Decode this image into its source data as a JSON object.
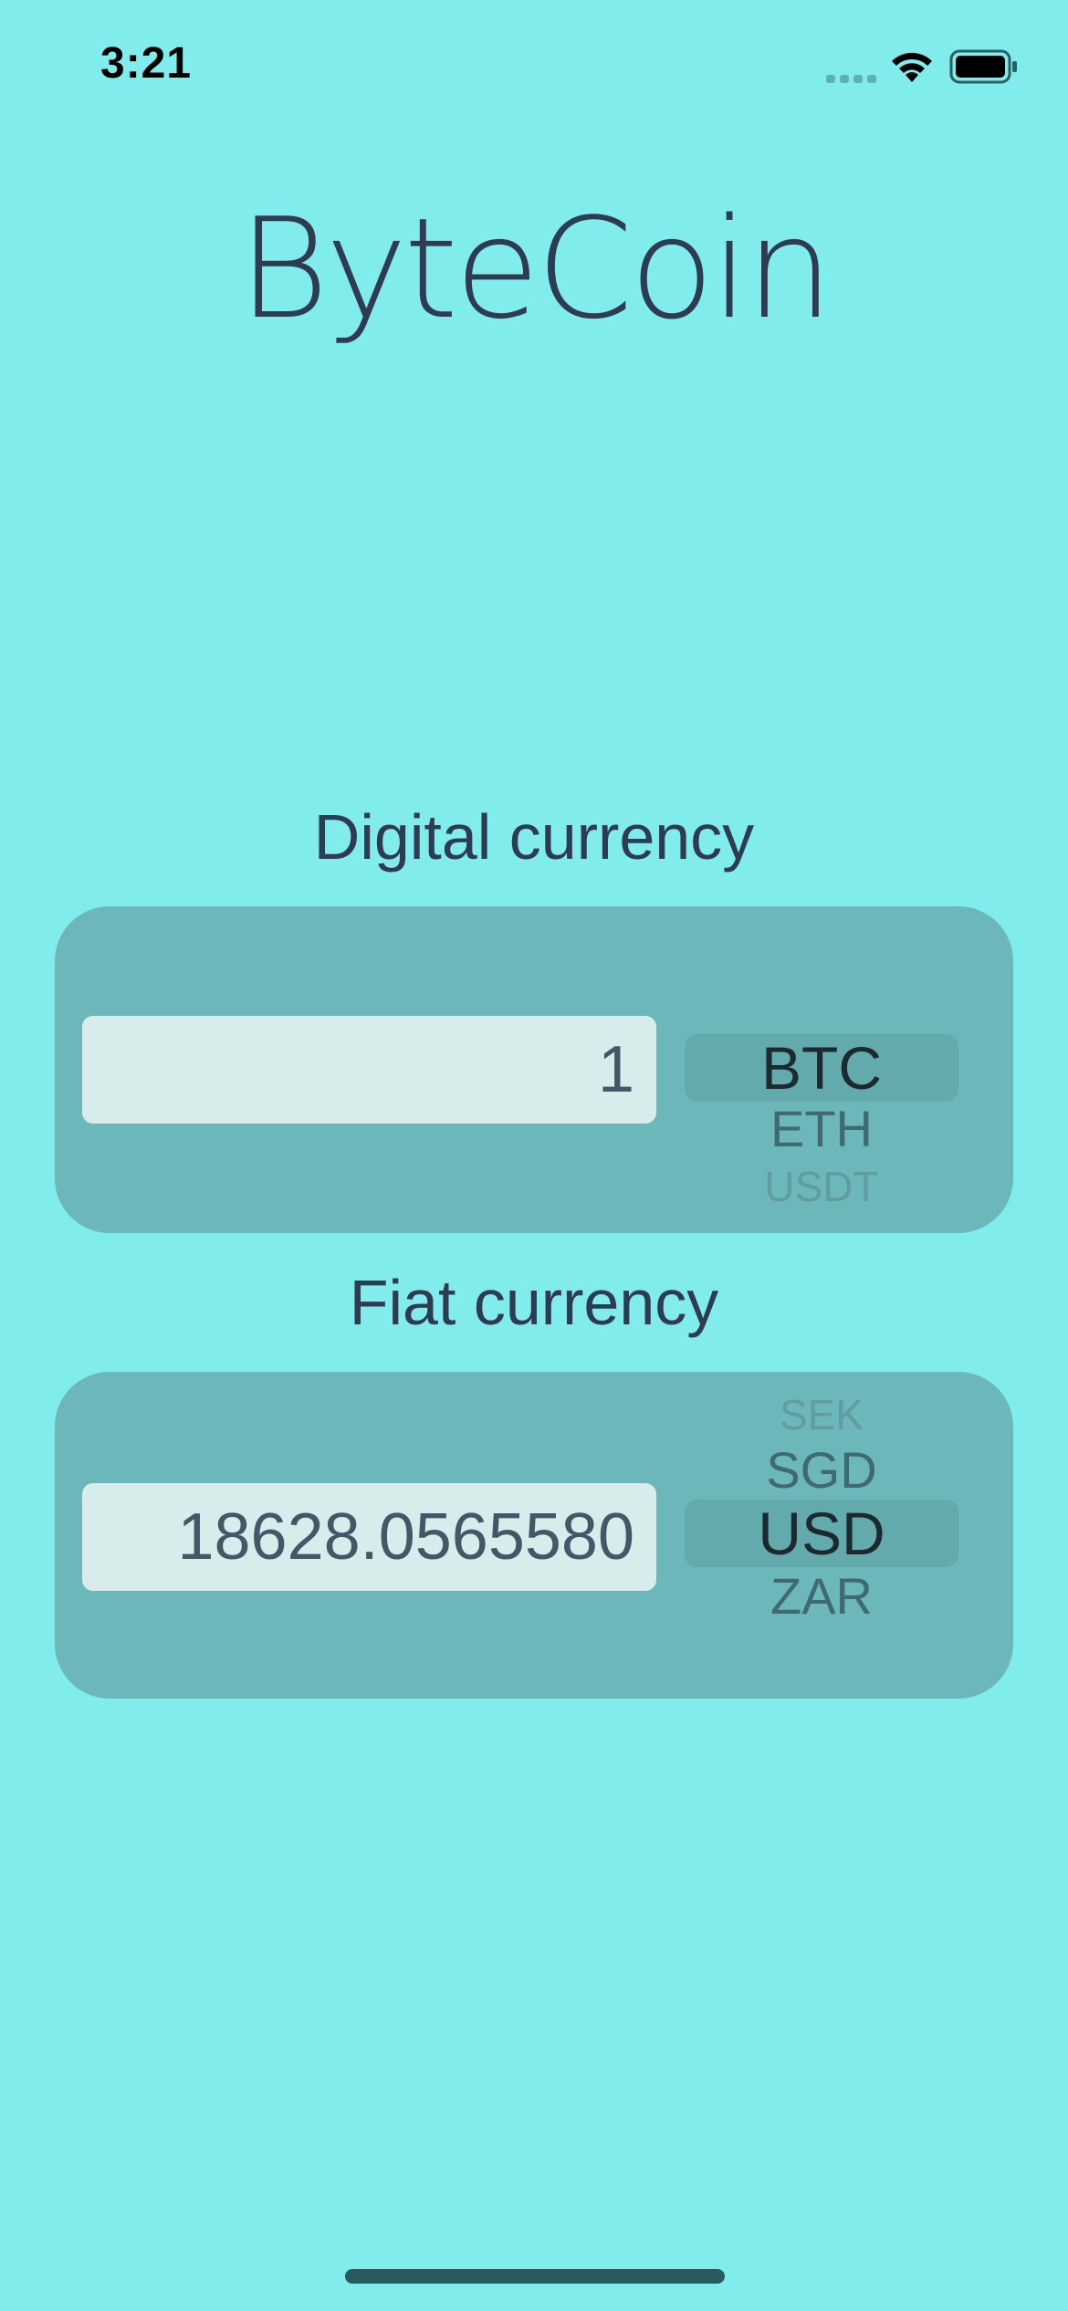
{
  "status_bar": {
    "time": "3:21"
  },
  "app": {
    "title": "ByteCoin"
  },
  "digital": {
    "label": "Digital currency",
    "amount": "1",
    "picker": {
      "selected": "BTC",
      "below_1": "ETH",
      "below_2": "USDT"
    }
  },
  "fiat": {
    "label": "Fiat currency",
    "amount": "18628.0565580",
    "picker": {
      "above_2": "SEK",
      "above_1": "SGD",
      "selected": "USD",
      "below_1": "ZAR"
    }
  },
  "colors": {
    "background": "#80ECEC",
    "panel": "#6CB7B9",
    "text": "#2E3B50"
  }
}
